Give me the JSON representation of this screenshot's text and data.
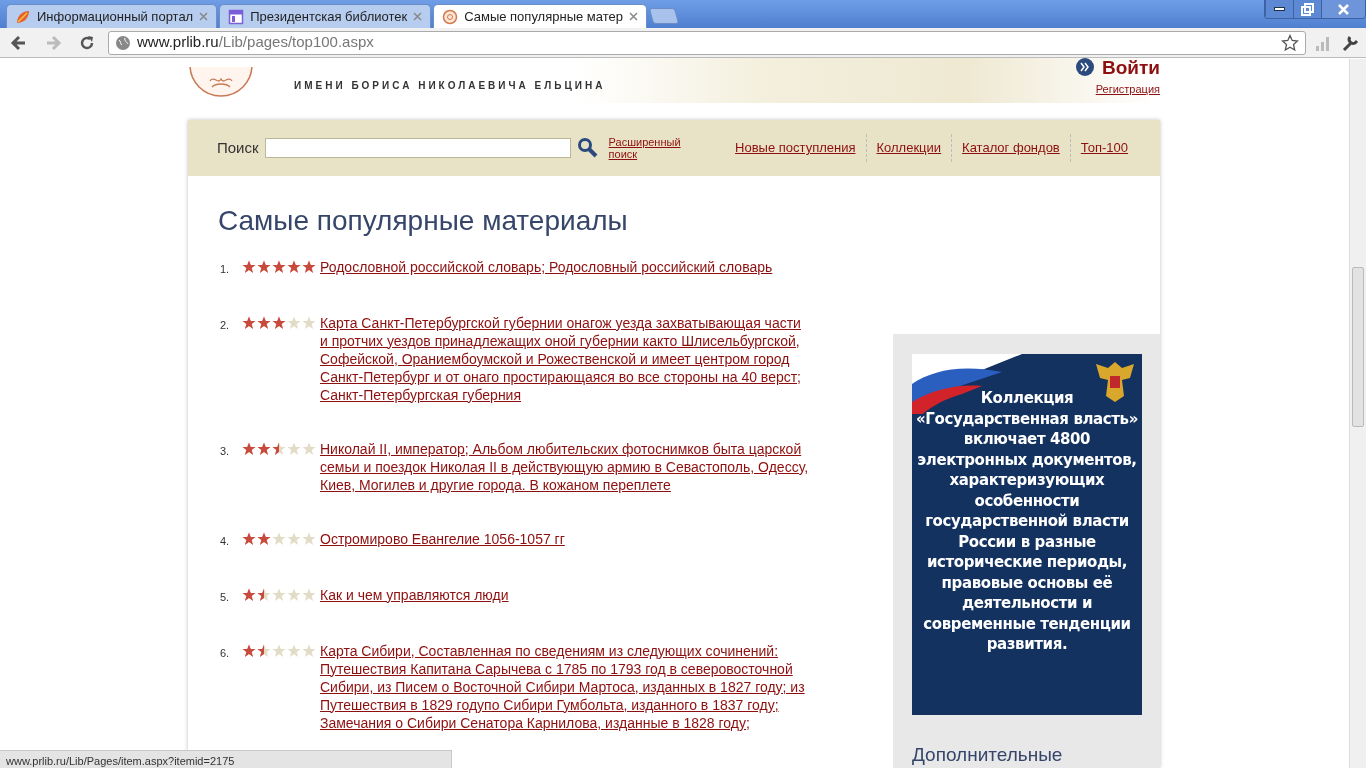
{
  "browser": {
    "tabs": [
      {
        "title": "Информационный портал",
        "selected": false
      },
      {
        "title": "Президентская библиотек",
        "selected": false
      },
      {
        "title": "Самые популярные матер",
        "selected": true
      }
    ],
    "address": {
      "host": "www.prlib.ru",
      "path": "/Lib/pages/top100.aspx"
    }
  },
  "header": {
    "subtitle": "ИМЕНИ БОРИСА НИКОЛАЕВИЧА ЕЛЬЦИНА",
    "login": "Войти",
    "register": "Регистрация"
  },
  "search": {
    "label": "Поиск",
    "advanced": "Расширенный поиск",
    "links": [
      "Новые поступления",
      "Коллекции",
      "Каталог фондов",
      "Топ-100"
    ]
  },
  "page_title": "Самые популярные материалы",
  "items": [
    {
      "number": "1.",
      "stars": 5,
      "title": "Родословной российской словарь; Родословный российский словарь"
    },
    {
      "number": "2.",
      "stars": 3,
      "title": "Карта Санкт-Петербургской губернии онагож уезда захватывающая части и протчих уездов принадлежащих оной губернии както Шлисельбургской, Софейской, Ораниембоумской и Рожественской и имеет центром город Санкт-Петербург и от онаго простирающаяся во все стороны на 40 верст; Санкт-Петербургская губерния"
    },
    {
      "number": "3.",
      "stars": 2.5,
      "title": "Николай II, император; Альбом любительских фотоснимков быта царской семьи и поездок Николая II в действующую армию в Севастополь, Одессу, Киев, Могилев и другие города. В кожаном переплете"
    },
    {
      "number": "4.",
      "stars": 2,
      "title": "Остромирово Евангелие 1056-1057 гг"
    },
    {
      "number": "5.",
      "stars": 1.5,
      "title": "Как и чем управляются люди"
    },
    {
      "number": "6.",
      "stars": 1.5,
      "title": "Карта Сибири, Составленная по сведениям из следующих сочинений: Путешествия Капитана Сарычева с 1785 по 1793 год в северовосточной Сибири, из Писем о Восточной Сибири Мартоса, изданных в 1827 году; из Путешествия в 1829 годупо Сибири Гумбольта, изданного в 1837 году; Замечания о Сибири Сенатора Карнилова, изданные в 1828 году;"
    }
  ],
  "sidebar": {
    "banner_text": "Коллекция «Государственная власть» включает 4800 электронных документов, характеризующих особенности государственной власти России в разные исторические периоды, правовые основы её деятельности и современные тенденции развития.",
    "heading": "Дополнительные"
  },
  "status_bar": "www.prlib.ru/Lib/Pages/item.aspx?itemid=2175"
}
